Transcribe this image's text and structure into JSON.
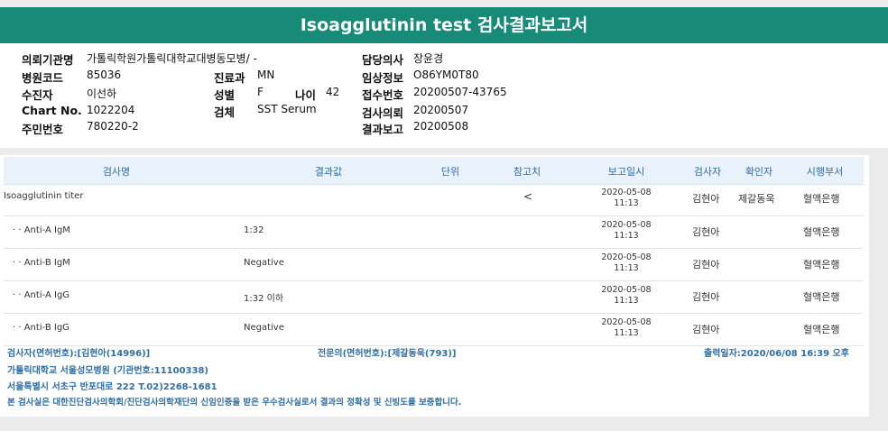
{
  "title": "Isoagglutinin test 검사결과보고서",
  "info": {
    "org_label": "의뢰기관명",
    "org_value": "가톨릭학원가톨릭대학교대병동모병/ -",
    "hospital_code_label": "병원코드",
    "hospital_code_value": "85036",
    "collector_label": "수진자",
    "collector_value": "이선하",
    "chart_label": "Chart No.",
    "chart_value": "1022204",
    "resident_label": "주민번호",
    "resident_value": "780220-2",
    "dept_label": "진료과",
    "dept_value": "MN",
    "sex_label": "성별",
    "sex_value": "F",
    "age_label": "나이",
    "age_value": "42",
    "specimen_label": "검체",
    "specimen_value": "SST Serum",
    "doctor_label": "담당의사",
    "doctor_value": "장윤경",
    "clinical_label": "임상정보",
    "clinical_value": "O86YM0T80",
    "receipt_label": "접수번호",
    "receipt_value": "20200507-43765",
    "request_label": "검사의뢰",
    "request_value": "20200507",
    "report_label": "결과보고",
    "report_value": "20200508"
  },
  "table": {
    "headers": {
      "name": "검사명",
      "result": "결과값",
      "unit": "단위",
      "ref": "참고치",
      "date": "보고일시",
      "tester": "검사자",
      "confirmer": "확인자",
      "dept": "시행부서"
    },
    "rows": [
      {
        "name": "Isoagglutinin titer",
        "result": "",
        "unit": "",
        "ref": "<",
        "date": "2020-05-08",
        "time": "11:13",
        "tester": "김현아",
        "confirmer": "제갈동욱",
        "dept": "혈액은행"
      },
      {
        "name": "· · Anti-A IgM",
        "result": "1:32",
        "unit": "",
        "ref": "",
        "date": "2020-05-08",
        "time": "11:13",
        "tester": "김현아",
        "confirmer": "",
        "dept": "혈액은행"
      },
      {
        "name": "· · Anti-B IgM",
        "result": "Negative",
        "unit": "",
        "ref": "",
        "date": "2020-05-08",
        "time": "11:13",
        "tester": "김현아",
        "confirmer": "",
        "dept": "혈액은행"
      },
      {
        "name": "· · Anti-A IgG",
        "result": "1:32 이하",
        "unit": "",
        "ref": "",
        "date": "2020-05-08",
        "time": "11:13",
        "tester": "김현아",
        "confirmer": "",
        "dept": "혈액은행"
      },
      {
        "name": "· · Anti-B IgG",
        "result": "Negative",
        "unit": "",
        "ref": "",
        "date": "2020-05-08",
        "time": "11:13",
        "tester": "김현아",
        "confirmer": "",
        "dept": "혈액은행"
      }
    ]
  },
  "footer": {
    "tester": "검사자(면허번호):[김현아(14996)]",
    "specialist": "전문의(면허번호):[제갈동욱(793)]",
    "print_date": "출력일자:2020/06/08 16:39 오후",
    "institution": "가톨릭대학교 서울성모병원 (기관번호:11100338)",
    "address": "서울특별시 서초구 반포대로 222 T.02)2268-1681",
    "certification": "본 검사실은 대한진단검사의학회/진단검사의학재단의 신임인증을 받은 우수검사실로서 결과의 정확성 및 신빙도를 보증합니다."
  }
}
